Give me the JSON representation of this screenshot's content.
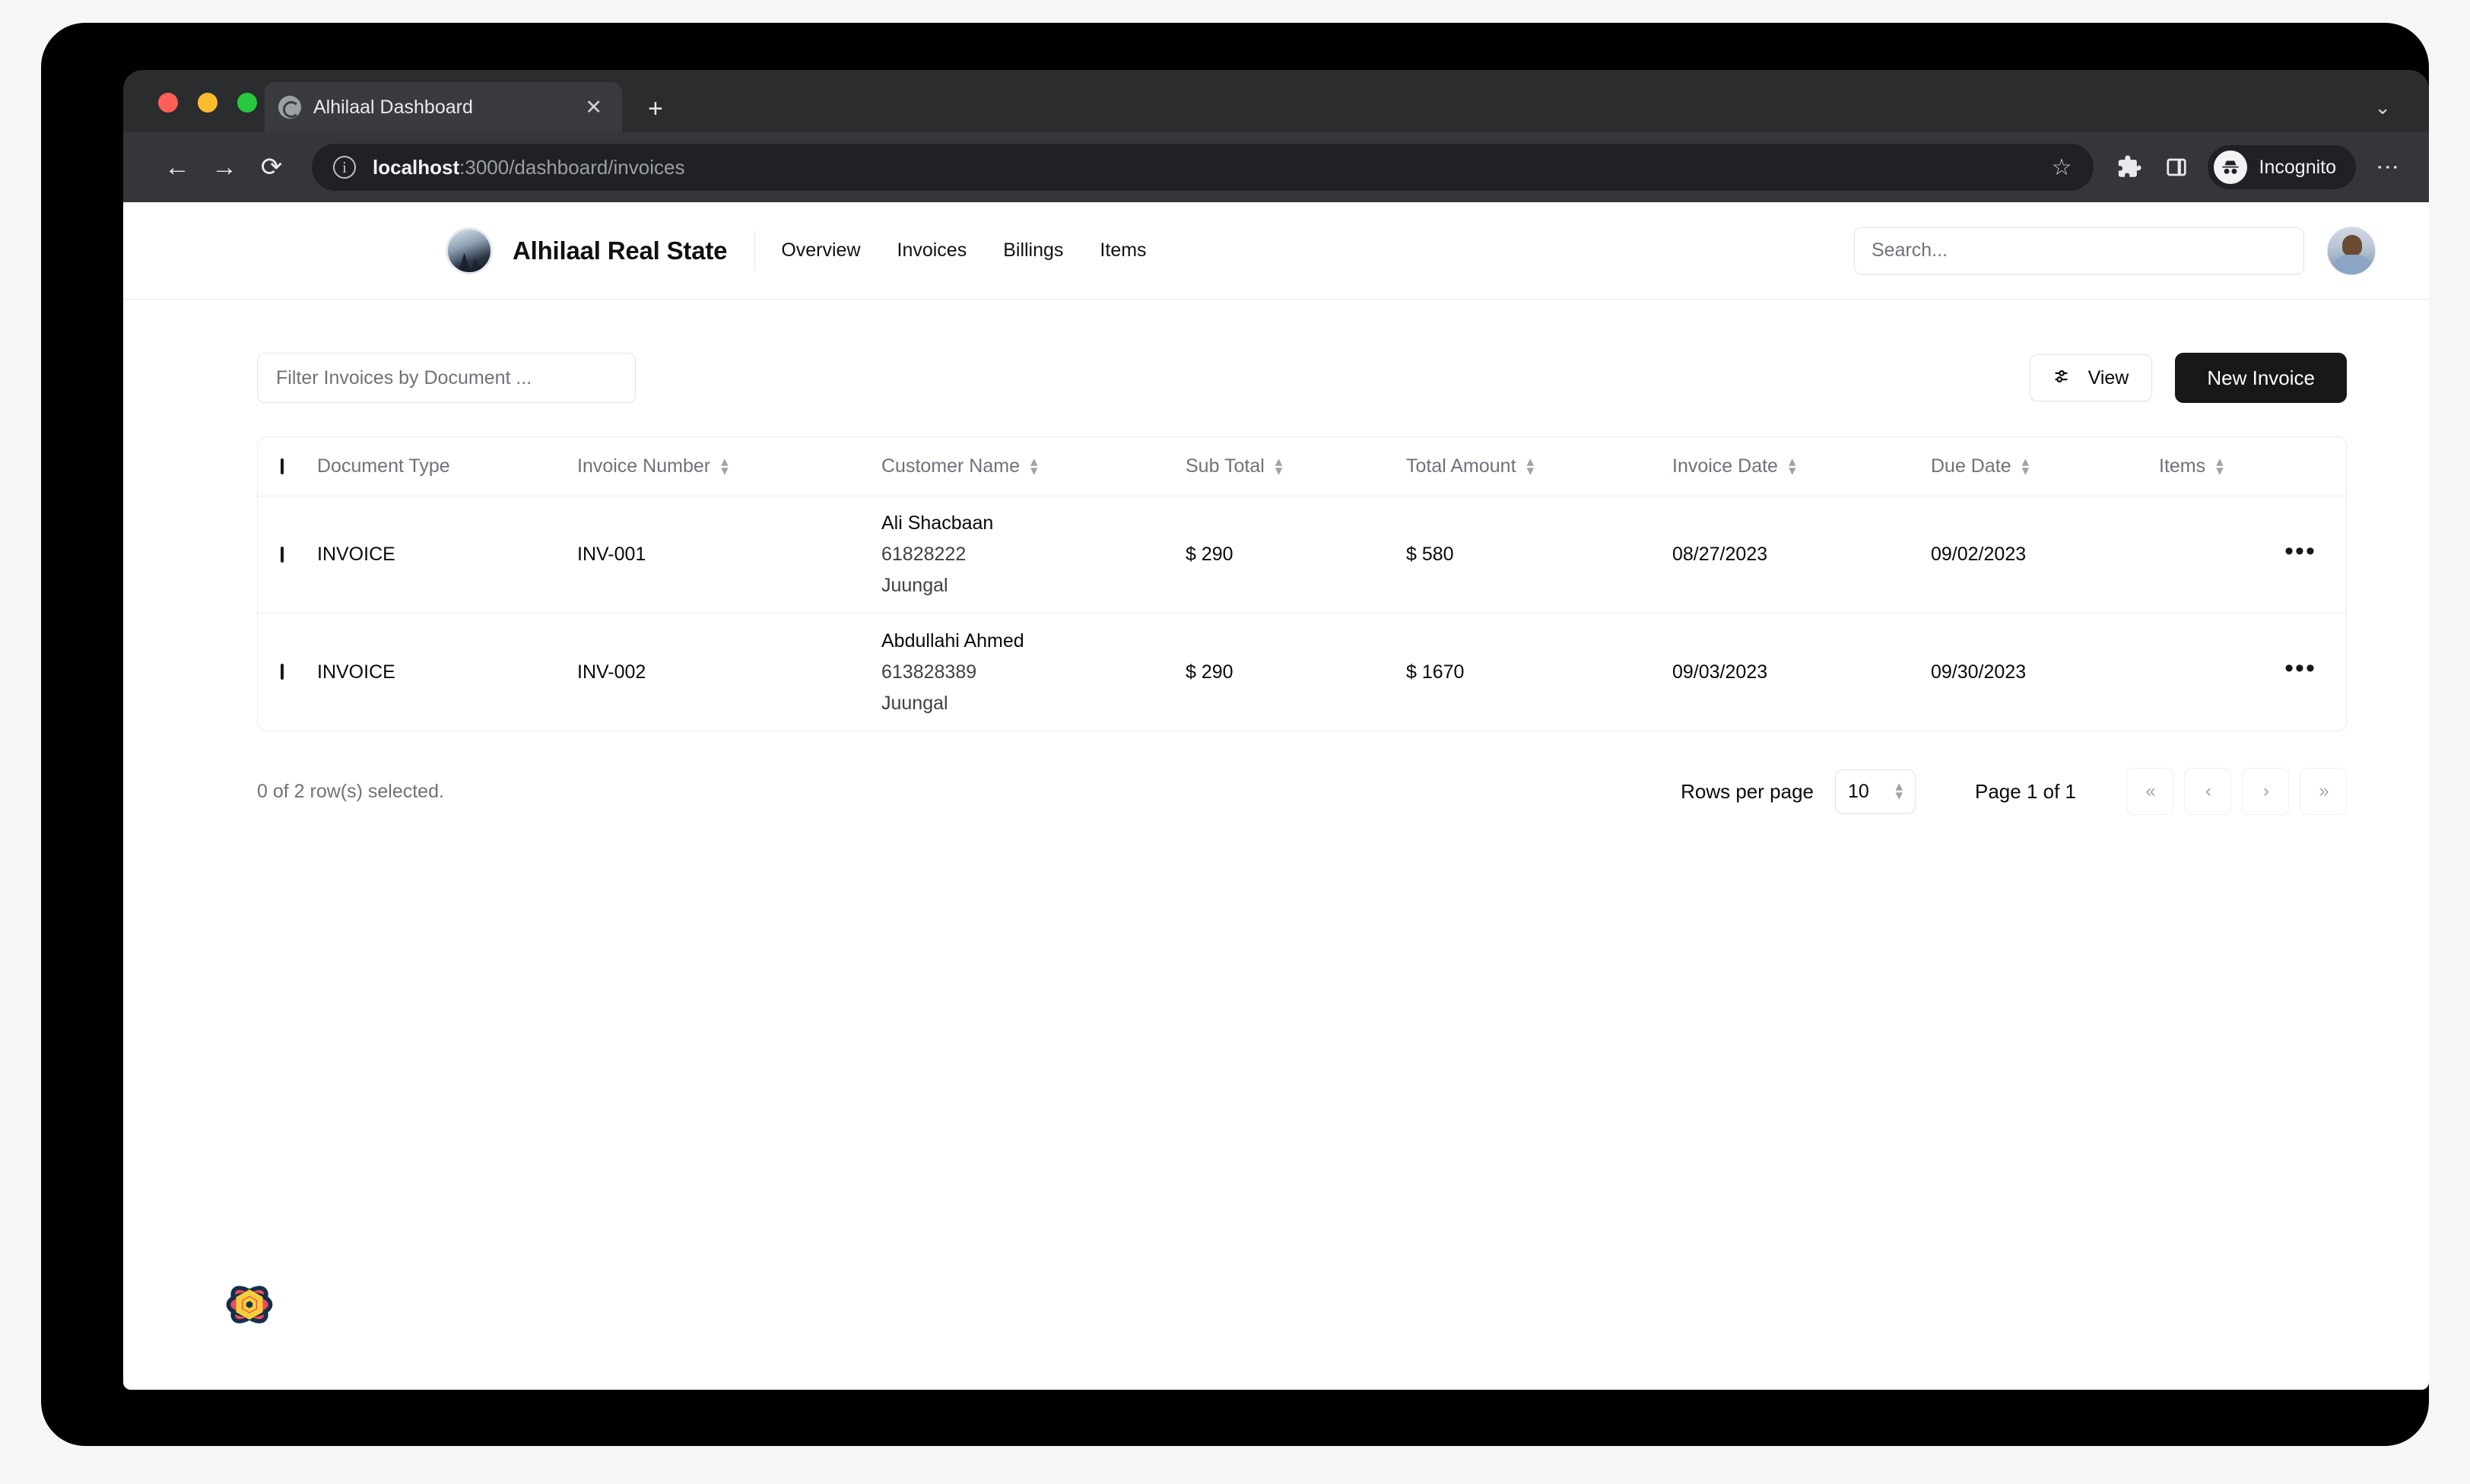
{
  "browser": {
    "tab_title": "Alhilaal Dashboard",
    "tab_close_label": "✕",
    "new_tab_label": "+",
    "tabstrip_chevron": "⌄",
    "back_label": "←",
    "forward_label": "→",
    "reload_label": "⟳",
    "site_info_label": "i",
    "url_host": "localhost",
    "url_path": ":3000/dashboard/invoices",
    "bookmark_label": "☆",
    "incognito_label": "Incognito",
    "menu_label": "⋮"
  },
  "header": {
    "brand_name": "Alhilaal Real State",
    "nav_items": [
      {
        "label": "Overview"
      },
      {
        "label": "Invoices"
      },
      {
        "label": "Billings"
      },
      {
        "label": "Items"
      }
    ],
    "search_placeholder": "Search..."
  },
  "toolbar": {
    "filter_placeholder": "Filter Invoices by Document ...",
    "view_label": "View",
    "new_invoice_label": "New Invoice"
  },
  "table": {
    "columns": [
      {
        "label": "Document Type",
        "sortable": false
      },
      {
        "label": "Invoice Number",
        "sortable": true
      },
      {
        "label": "Customer Name",
        "sortable": true
      },
      {
        "label": "Sub Total",
        "sortable": true
      },
      {
        "label": "Total Amount",
        "sortable": true
      },
      {
        "label": "Invoice Date",
        "sortable": true
      },
      {
        "label": "Due Date",
        "sortable": true
      },
      {
        "label": "Items",
        "sortable": true
      }
    ],
    "rows": [
      {
        "document_type": "INVOICE",
        "invoice_number": "INV-001",
        "customer_name": "Ali Shacbaan",
        "customer_phone": "61828222",
        "customer_location": "Juungal",
        "sub_total": "$ 290",
        "total_amount": "$ 580",
        "invoice_date": "08/27/2023",
        "due_date": "09/02/2023",
        "items": "",
        "menu_label": "•••"
      },
      {
        "document_type": "INVOICE",
        "invoice_number": "INV-002",
        "customer_name": "Abdullahi Ahmed",
        "customer_phone": "613828389",
        "customer_location": "Juungal",
        "sub_total": "$ 290",
        "total_amount": "$ 1670",
        "invoice_date": "09/03/2023",
        "due_date": "09/30/2023",
        "items": "",
        "menu_label": "•••"
      }
    ]
  },
  "footer": {
    "rows_selected": "0 of 2 row(s) selected.",
    "rows_per_page_label": "Rows per page",
    "rows_per_page_value": "10",
    "page_indicator": "Page 1 of 1",
    "first_page_label": "«",
    "prev_page_label": "‹",
    "next_page_label": "›",
    "last_page_label": "»"
  },
  "colors": {
    "accent_dark": "#18181b",
    "muted_text": "#71717a",
    "border": "#ececee",
    "badge_petal": "#f4475c",
    "badge_center": "#f5cf3a",
    "badge_outline": "#123049"
  }
}
